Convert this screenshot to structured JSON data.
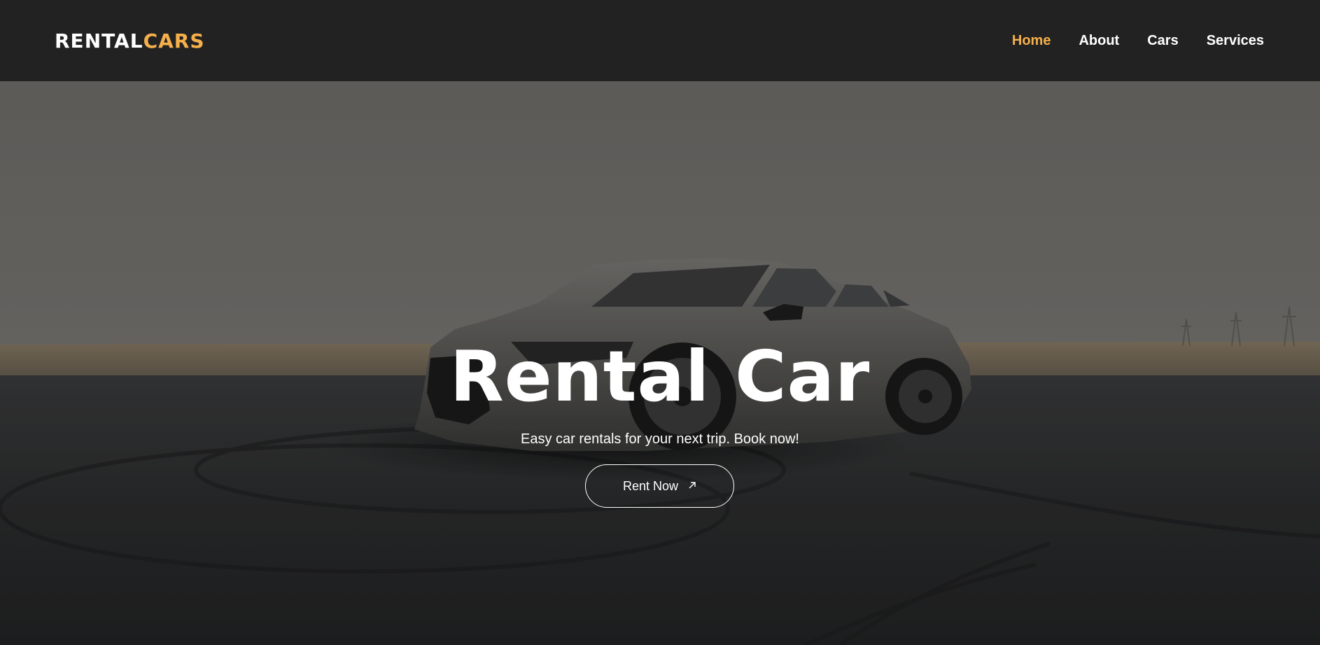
{
  "header": {
    "logo_part1": "RENTAL",
    "logo_part2": "CARS",
    "nav": [
      {
        "label": "Home",
        "active": true
      },
      {
        "label": "About",
        "active": false
      },
      {
        "label": "Cars",
        "active": false
      },
      {
        "label": "Services",
        "active": false
      }
    ]
  },
  "hero": {
    "title": "Rental Car",
    "subtitle": "Easy car rentals for your next trip. Book now!",
    "cta_label": "Rent Now",
    "cta_icon": "arrow-up-right-icon"
  },
  "colors": {
    "header_bg": "#222222",
    "accent": "#f5b04b",
    "text": "#ffffff"
  }
}
